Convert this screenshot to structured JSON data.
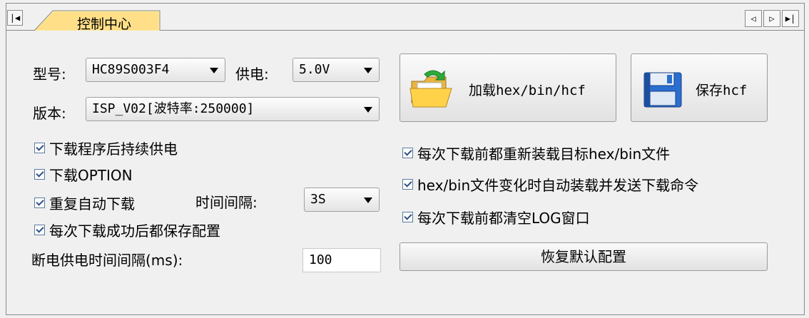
{
  "tab": {
    "title": "控制中心",
    "first_glyph": "|◀",
    "prev_glyph": "◁",
    "next_glyph": "▷",
    "last_glyph": "▶|"
  },
  "model": {
    "label": "型号:",
    "value": "HC89S003F4"
  },
  "power": {
    "label": "供电:",
    "value": "5.0V"
  },
  "version": {
    "label": "版本:",
    "value": "ISP_V02[波特率:250000]"
  },
  "buttons": {
    "load": "加载hex/bin/hcf",
    "save": "保存hcf",
    "reset": "恢复默认配置"
  },
  "options_left": [
    {
      "label": "下载程序后持续供电",
      "checked": true
    },
    {
      "label": "下载OPTION",
      "checked": true
    },
    {
      "label": "重复自动下载",
      "checked": true
    },
    {
      "label": "每次下载成功后都保存配置",
      "checked": true
    }
  ],
  "interval": {
    "label": "时间间隔:",
    "value": "3S"
  },
  "power_off": {
    "label": "断电供电时间间隔(ms):",
    "value": "100"
  },
  "options_right": [
    {
      "label": "每次下载前都重新装载目标hex/bin文件",
      "checked": true
    },
    {
      "label": "hex/bin文件变化时自动装载并发送下载命令",
      "checked": true
    },
    {
      "label": "每次下载前都清空LOG窗口",
      "checked": true
    }
  ]
}
